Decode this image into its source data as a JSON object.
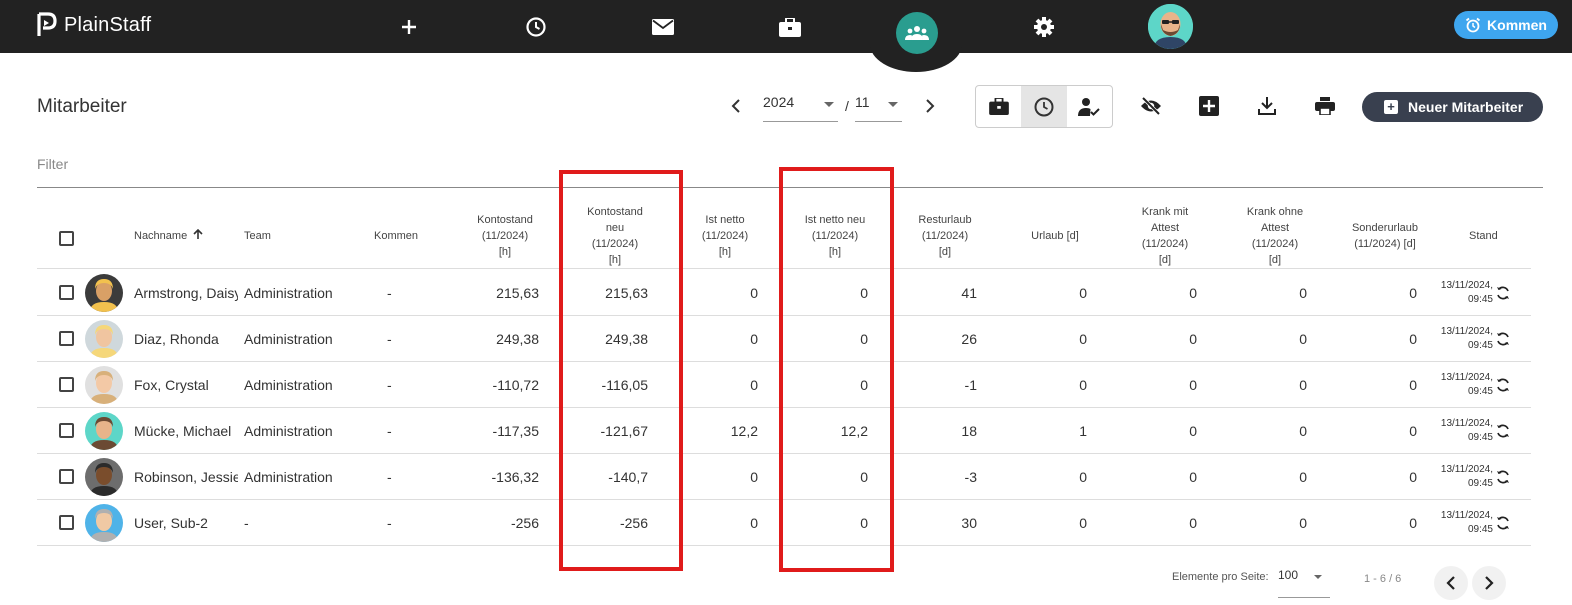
{
  "app": {
    "name": "PlainStaff"
  },
  "topbar": {
    "kommen_label": "Kommen",
    "icons": [
      "plus-icon",
      "clock-icon",
      "mail-icon",
      "briefcase-icon",
      "team-icon",
      "gear-icon",
      "avatar"
    ]
  },
  "page": {
    "title": "Mitarbeiter"
  },
  "period": {
    "year": "2024",
    "month": "11",
    "separator": "/"
  },
  "toolbar": {
    "new_employee_label": "Neuer Mitarbeiter"
  },
  "filter": {
    "placeholder": "Filter"
  },
  "table": {
    "headers": {
      "nachname": "Nachname",
      "team": "Team",
      "kommen": "Kommen",
      "kontostand": [
        "Kontostand",
        "(11/2024)",
        "[h]"
      ],
      "kontostand_neu": [
        "Kontostand",
        "neu",
        "(11/2024)",
        "[h]"
      ],
      "ist_netto": [
        "Ist netto",
        "(11/2024)",
        "[h]"
      ],
      "ist_netto_neu": [
        "Ist netto neu",
        "(11/2024)",
        "[h]"
      ],
      "resturlaub": [
        "Resturlaub",
        "(11/2024)",
        "[d]"
      ],
      "urlaub": "Urlaub [d]",
      "krank_mit": [
        "Krank mit",
        "Attest",
        "(11/2024)",
        "[d]"
      ],
      "krank_ohne": [
        "Krank ohne",
        "Attest",
        "(11/2024)",
        "[d]"
      ],
      "sonderurlaub": [
        "Sonderurlaub",
        "(11/2024) [d]"
      ],
      "stand": "Stand"
    },
    "rows": [
      {
        "name": "Armstrong, Daisy",
        "team": "Administration",
        "kommen": "-",
        "kontostand": "215,63",
        "kontostand_neu": "215,63",
        "ist_netto": "0",
        "ist_netto_neu": "0",
        "resturlaub": "41",
        "urlaub": "0",
        "krank_mit": "0",
        "krank_ohne": "0",
        "sonderurlaub": "0",
        "stand_date": "13/11/2024,",
        "stand_time": "09:45"
      },
      {
        "name": "Diaz, Rhonda",
        "team": "Administration",
        "kommen": "-",
        "kontostand": "249,38",
        "kontostand_neu": "249,38",
        "ist_netto": "0",
        "ist_netto_neu": "0",
        "resturlaub": "26",
        "urlaub": "0",
        "krank_mit": "0",
        "krank_ohne": "0",
        "sonderurlaub": "0",
        "stand_date": "13/11/2024,",
        "stand_time": "09:45"
      },
      {
        "name": "Fox, Crystal",
        "team": "Administration",
        "kommen": "-",
        "kontostand": "-110,72",
        "kontostand_neu": "-116,05",
        "ist_netto": "0",
        "ist_netto_neu": "0",
        "resturlaub": "-1",
        "urlaub": "0",
        "krank_mit": "0",
        "krank_ohne": "0",
        "sonderurlaub": "0",
        "stand_date": "13/11/2024,",
        "stand_time": "09:45"
      },
      {
        "name": "Mücke, Michael",
        "team": "Administration",
        "kommen": "-",
        "kontostand": "-117,35",
        "kontostand_neu": "-121,67",
        "ist_netto": "12,2",
        "ist_netto_neu": "12,2",
        "resturlaub": "18",
        "urlaub": "1",
        "krank_mit": "0",
        "krank_ohne": "0",
        "sonderurlaub": "0",
        "stand_date": "13/11/2024,",
        "stand_time": "09:45"
      },
      {
        "name": "Robinson, Jessie",
        "team": "Administration",
        "kommen": "-",
        "kontostand": "-136,32",
        "kontostand_neu": "-140,7",
        "ist_netto": "0",
        "ist_netto_neu": "0",
        "resturlaub": "-3",
        "urlaub": "0",
        "krank_mit": "0",
        "krank_ohne": "0",
        "sonderurlaub": "0",
        "stand_date": "13/11/2024,",
        "stand_time": "09:45"
      },
      {
        "name": "User, Sub-2",
        "team": "-",
        "kommen": "-",
        "kontostand": "-256",
        "kontostand_neu": "-256",
        "ist_netto": "0",
        "ist_netto_neu": "0",
        "resturlaub": "30",
        "urlaub": "0",
        "krank_mit": "0",
        "krank_ohne": "0",
        "sonderurlaub": "0",
        "stand_date": "13/11/2024,",
        "stand_time": "09:45"
      }
    ]
  },
  "pagination": {
    "per_page_label": "Elemente pro Seite:",
    "per_page_value": "100",
    "range": "1 - 6 / 6"
  },
  "colors": {
    "topbar": "#222222",
    "accent": "#3ea6ef",
    "active_nav": "#2a9d8f",
    "highlight": "#e01b1b",
    "button_dark": "#39404f"
  }
}
